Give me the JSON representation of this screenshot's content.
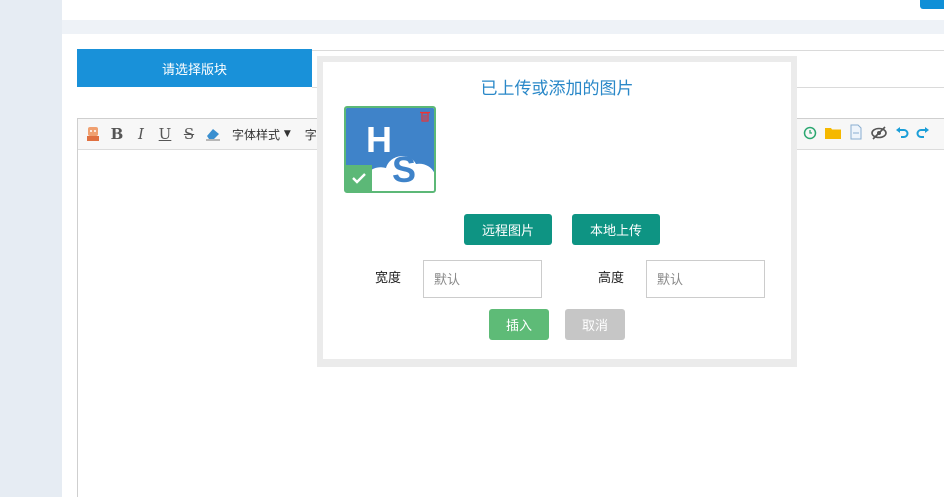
{
  "board_select": {
    "label": "请选择版块"
  },
  "toolbar": {
    "font_style_label": "字体样式",
    "font_style_caret": "▼",
    "truncated_label": "字"
  },
  "dialog": {
    "title": "已上传或添加的图片",
    "thumbnail": {
      "logo_letters": [
        "H",
        "S"
      ],
      "selected": true
    },
    "remote_button": "远程图片",
    "local_button": "本地上传",
    "width_label": "宽度",
    "width_placeholder": "默认",
    "height_label": "高度",
    "height_placeholder": "默认",
    "insert_button": "插入",
    "cancel_button": "取消"
  },
  "colors": {
    "primary_blue": "#1991d9",
    "title_blue": "#2a88c8",
    "teal": "#0e9483",
    "green": "#5ebb77",
    "gray": "#c6c6c6",
    "logo_blue": "#3f83c9"
  },
  "icons": [
    "emoticon-icon",
    "bold-icon",
    "italic-icon",
    "underline-icon",
    "strikethrough-icon",
    "eraser-icon",
    "clock-icon",
    "folder-icon",
    "file-icon",
    "hide-icon",
    "undo-icon",
    "redo-icon",
    "delete-icon",
    "check-icon"
  ]
}
